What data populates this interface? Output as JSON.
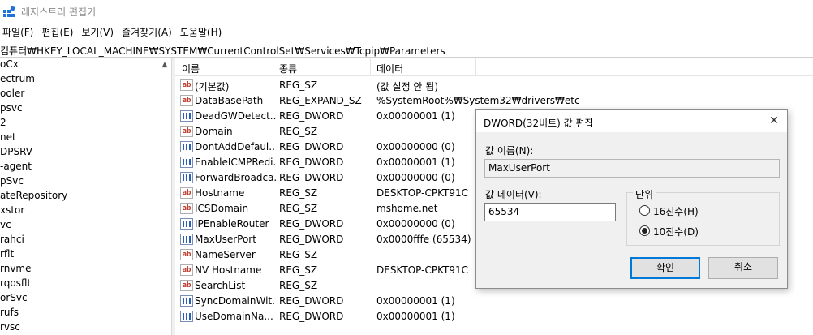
{
  "window": {
    "title": "레지스트리 편집기",
    "icon": "registry-editor-icon"
  },
  "menu": [
    "파일(F)",
    "편집(E)",
    "보기(V)",
    "즐겨찾기(A)",
    "도움말(H)"
  ],
  "address": "컴퓨터₩HKEY_LOCAL_MACHINE₩SYSTEM₩CurrentControlSet₩Services₩Tcpip₩Parameters",
  "tree": [
    "oCx",
    "ectrum",
    "ooler",
    "psvc",
    "2",
    "net",
    "DPSRV",
    "-agent",
    "pSvc",
    "ateRepository",
    "xstor",
    "vc",
    "rahci",
    "rflt",
    "rnvme",
    "rqosflt",
    "orSvc",
    "rufs",
    "rvsc"
  ],
  "columns": {
    "name": "이름",
    "type": "종류",
    "data": "데이터"
  },
  "values": [
    {
      "icon": "string-value-icon",
      "name": "(기본값)",
      "type": "REG_SZ",
      "data": "(값 설정 안 됨)"
    },
    {
      "icon": "string-value-icon",
      "name": "DataBasePath",
      "type": "REG_EXPAND_SZ",
      "data": "%SystemRoot%₩System32₩drivers₩etc"
    },
    {
      "icon": "binary-value-icon",
      "name": "DeadGWDetect...",
      "type": "REG_DWORD",
      "data": "0x00000001 (1)"
    },
    {
      "icon": "string-value-icon",
      "name": "Domain",
      "type": "REG_SZ",
      "data": ""
    },
    {
      "icon": "binary-value-icon",
      "name": "DontAddDefaul...",
      "type": "REG_DWORD",
      "data": "0x00000000 (0)"
    },
    {
      "icon": "binary-value-icon",
      "name": "EnableICMPRedi...",
      "type": "REG_DWORD",
      "data": "0x00000001 (1)"
    },
    {
      "icon": "binary-value-icon",
      "name": "ForwardBroadca...",
      "type": "REG_DWORD",
      "data": "0x00000000 (0)"
    },
    {
      "icon": "string-value-icon",
      "name": "Hostname",
      "type": "REG_SZ",
      "data": "DESKTOP-CPKT91C"
    },
    {
      "icon": "string-value-icon",
      "name": "ICSDomain",
      "type": "REG_SZ",
      "data": "mshome.net"
    },
    {
      "icon": "binary-value-icon",
      "name": "IPEnableRouter",
      "type": "REG_DWORD",
      "data": "0x00000000 (0)"
    },
    {
      "icon": "binary-value-icon",
      "name": "MaxUserPort",
      "type": "REG_DWORD",
      "data": "0x0000fffe (65534)"
    },
    {
      "icon": "string-value-icon",
      "name": "NameServer",
      "type": "REG_SZ",
      "data": ""
    },
    {
      "icon": "string-value-icon",
      "name": "NV Hostname",
      "type": "REG_SZ",
      "data": "DESKTOP-CPKT91C"
    },
    {
      "icon": "string-value-icon",
      "name": "SearchList",
      "type": "REG_SZ",
      "data": ""
    },
    {
      "icon": "binary-value-icon",
      "name": "SyncDomainWit...",
      "type": "REG_DWORD",
      "data": "0x00000001 (1)"
    },
    {
      "icon": "binary-value-icon",
      "name": "UseDomainNa...",
      "type": "REG_DWORD",
      "data": "0x00000001 (1)"
    }
  ],
  "dialog": {
    "title": "DWORD(32비트) 값 편집",
    "close_icon": "close-icon",
    "value_name_label": "값 이름(N):",
    "value_name": "MaxUserPort",
    "value_data_label": "값 데이터(V):",
    "value_data": "65534",
    "base_label": "단위",
    "base_options": [
      "16진수(H)",
      "10진수(D)"
    ],
    "base_selected": "10진수(D)",
    "ok": "확인",
    "cancel": "취소"
  },
  "colors": {
    "accent": "#0078d7",
    "dialog_bg": "#f0f0f0",
    "title_text": "#8a8a8a"
  }
}
